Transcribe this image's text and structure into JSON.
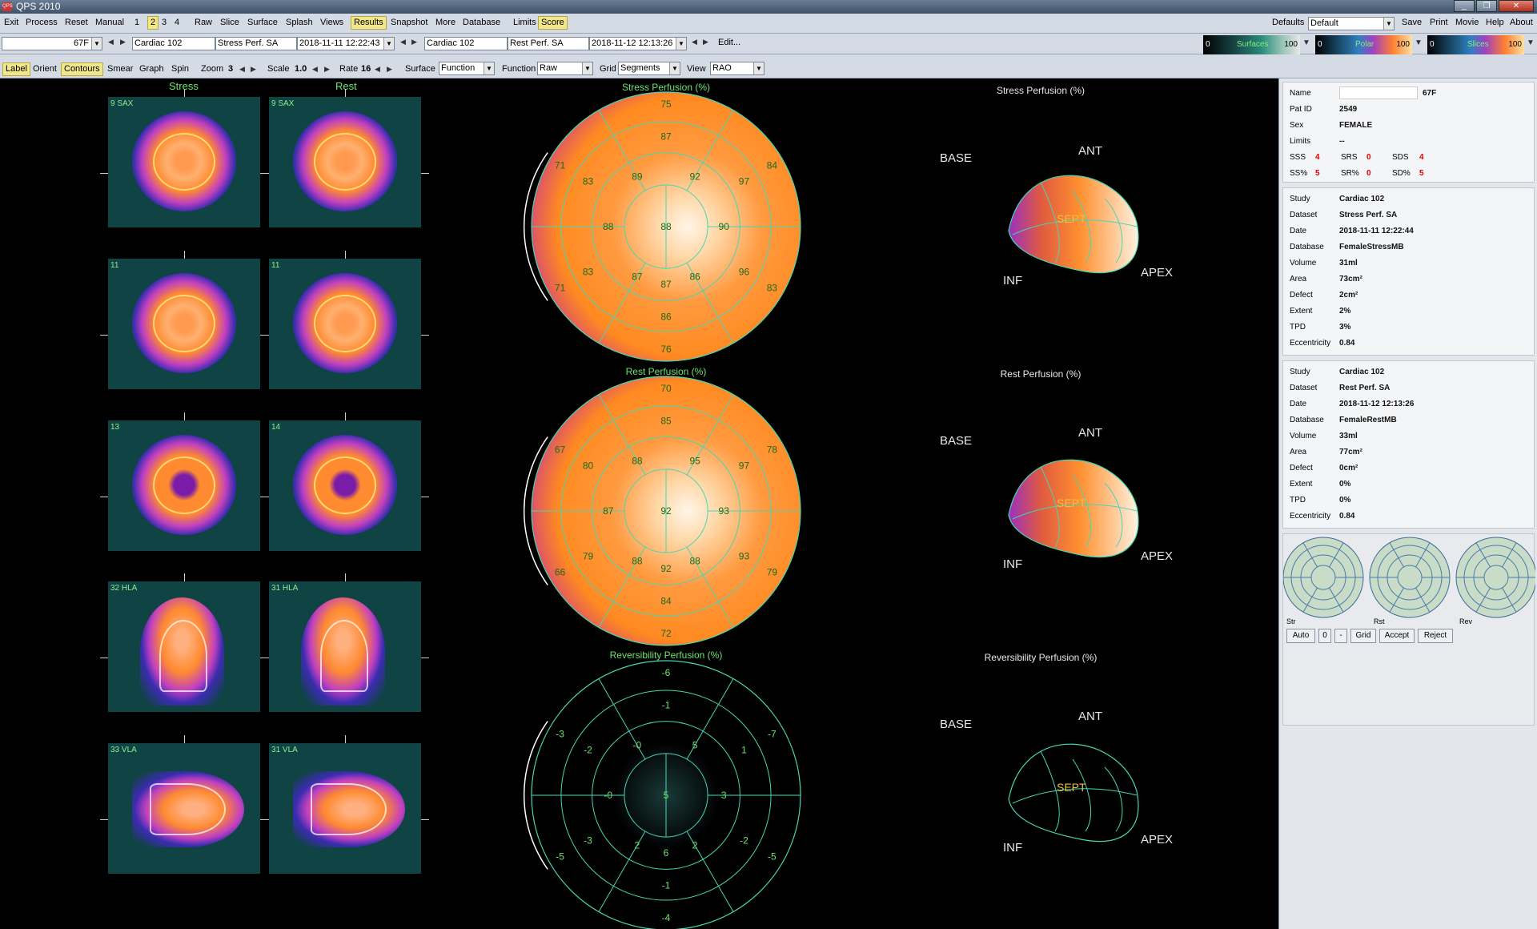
{
  "window": {
    "title": "QPS 2010",
    "icon_text": "QPS"
  },
  "menu": {
    "items": [
      "Exit",
      "Process",
      "Reset",
      "Manual"
    ],
    "pages": [
      "1",
      "2",
      "3",
      "4"
    ],
    "selected_page": "2",
    "modes": [
      "Raw",
      "Slice",
      "Surface",
      "Splash",
      "Views",
      "Results",
      "Snapshot",
      "More",
      "Database"
    ],
    "selected_mode": "Results",
    "limits": "Limits",
    "score": "Score",
    "defaults_label": "Defaults",
    "defaults_value": "Default",
    "right_items": [
      "Save",
      "Print",
      "Movie",
      "Help",
      "About"
    ]
  },
  "toolbar2": {
    "patient_field": "67F",
    "stress_study": "Cardiac 102",
    "stress_dataset": "Stress Perf. SA",
    "stress_date": "2018-11-11 12:22:43",
    "rest_study": "Cardiac 102",
    "rest_dataset": "Rest Perf. SA",
    "rest_date": "2018-11-12 12:13:26",
    "edit": "Edit...",
    "colorbars": [
      {
        "name": "Surfaces",
        "min": "0",
        "max": "100"
      },
      {
        "name": "Polar",
        "min": "0",
        "max": "100"
      },
      {
        "name": "Slices",
        "min": "0",
        "max": "100"
      }
    ]
  },
  "toolbar3": {
    "label": "Label",
    "orient": "Orient",
    "contours": "Contours",
    "smear": "Smear",
    "graph": "Graph",
    "spin": "Spin",
    "zoom_label": "Zoom",
    "zoom_value": "3",
    "scale_label": "Scale",
    "scale_value": "1.0",
    "rate_label": "Rate",
    "rate_value": "16",
    "surface_label": "Surface",
    "surface_value": "Function",
    "function_label": "Function",
    "function_value": "Raw",
    "grid_label": "Grid",
    "grid_value": "Segments",
    "view_label": "View",
    "view_value": "RAO"
  },
  "slices": {
    "stress_title": "Stress",
    "rest_title": "Rest",
    "stress_labels": [
      "9 SAX",
      "11",
      "13",
      "32 HLA",
      "33 VLA"
    ],
    "rest_labels": [
      "9 SAX",
      "11",
      "14",
      "31 HLA",
      "31 VLA"
    ]
  },
  "polar": {
    "stress": {
      "title": "Stress Perfusion (%)",
      "values": {
        "apex": "88",
        "ring1": [
          "89",
          "92",
          "90",
          "86",
          "87",
          "88"
        ],
        "ring2": [
          "87",
          "97",
          "96",
          "86",
          "83",
          "83"
        ],
        "ring3": [
          "75",
          "84",
          "83",
          "76",
          "71",
          "71"
        ],
        "extra": [
          "87"
        ]
      }
    },
    "rest": {
      "title": "Rest Perfusion (%)",
      "values": {
        "apex": "92",
        "ring1": [
          "88",
          "95",
          "93",
          "88",
          "88",
          "87"
        ],
        "ring2": [
          "85",
          "97",
          "93",
          "84",
          "79",
          "80"
        ],
        "ring3": [
          "70",
          "78",
          "79",
          "72",
          "66",
          "67"
        ],
        "extra": [
          "92"
        ]
      }
    },
    "rev": {
      "title": "Reversibility Perfusion (%)",
      "values": {
        "apex": "5",
        "ring1": [
          "-0",
          "5",
          "3",
          "2",
          "2",
          "-0"
        ],
        "ring2": [
          "-1",
          "1",
          "-2",
          "-1",
          "-3",
          "-2"
        ],
        "ring3": [
          "-6",
          "-7",
          "-5",
          "-4",
          "-5",
          "-3"
        ],
        "extra": [
          "6"
        ]
      }
    }
  },
  "surfaces": {
    "stress_title": "Stress Perfusion (%)",
    "rest_title": "Rest Perfusion (%)",
    "rev_title": "Reversibility Perfusion (%)",
    "base": "BASE",
    "ant": "ANT",
    "inf": "INF",
    "apex": "APEX",
    "sept": "SEPT"
  },
  "patient": {
    "name_label": "Name",
    "name_value": "67F",
    "patid_label": "Pat ID",
    "patid_value": "2549",
    "sex_label": "Sex",
    "sex_value": "FEMALE",
    "limits_label": "Limits",
    "limits_value": "--",
    "sss_label": "SSS",
    "sss_value": "4",
    "srs_label": "SRS",
    "srs_value": "0",
    "sds_label": "SDS",
    "sds_value": "4",
    "ssp_label": "SS%",
    "ssp_value": "5",
    "srp_label": "SR%",
    "srp_value": "0",
    "sdp_label": "SD%",
    "sdp_value": "5"
  },
  "stress_study": {
    "rows": [
      {
        "label": "Study",
        "value": "Cardiac 102"
      },
      {
        "label": "Dataset",
        "value": "Stress Perf. SA"
      },
      {
        "label": "Date",
        "value": "2018-11-11 12:22:44"
      },
      {
        "label": "Database",
        "value": "FemaleStressMB"
      },
      {
        "label": "Volume",
        "value": "31ml"
      },
      {
        "label": "Area",
        "value": "73cm²"
      },
      {
        "label": "Defect",
        "value": "2cm²"
      },
      {
        "label": "Extent",
        "value": "2%"
      },
      {
        "label": "TPD",
        "value": "3%"
      },
      {
        "label": "Eccentricity",
        "value": "0.84"
      }
    ]
  },
  "rest_study": {
    "rows": [
      {
        "label": "Study",
        "value": "Cardiac 102"
      },
      {
        "label": "Dataset",
        "value": "Rest Perf. SA"
      },
      {
        "label": "Date",
        "value": "2018-11-12 12:13:26"
      },
      {
        "label": "Database",
        "value": "FemaleRestMB"
      },
      {
        "label": "Volume",
        "value": "33ml"
      },
      {
        "label": "Area",
        "value": "77cm²"
      },
      {
        "label": "Defect",
        "value": "0cm²"
      },
      {
        "label": "Extent",
        "value": "0%"
      },
      {
        "label": "TPD",
        "value": "0%"
      },
      {
        "label": "Eccentricity",
        "value": "0.84"
      }
    ]
  },
  "score_maps": {
    "labels": [
      "Str",
      "Rst",
      "Rev"
    ]
  },
  "score_buttons": [
    "Auto",
    "0",
    "-",
    "Grid",
    "Accept",
    "Reject"
  ],
  "colors": {
    "accent_green": "#6de36d",
    "panel": "#d4dbe5",
    "selected": "#f0e68c",
    "alert": "#e00000"
  }
}
